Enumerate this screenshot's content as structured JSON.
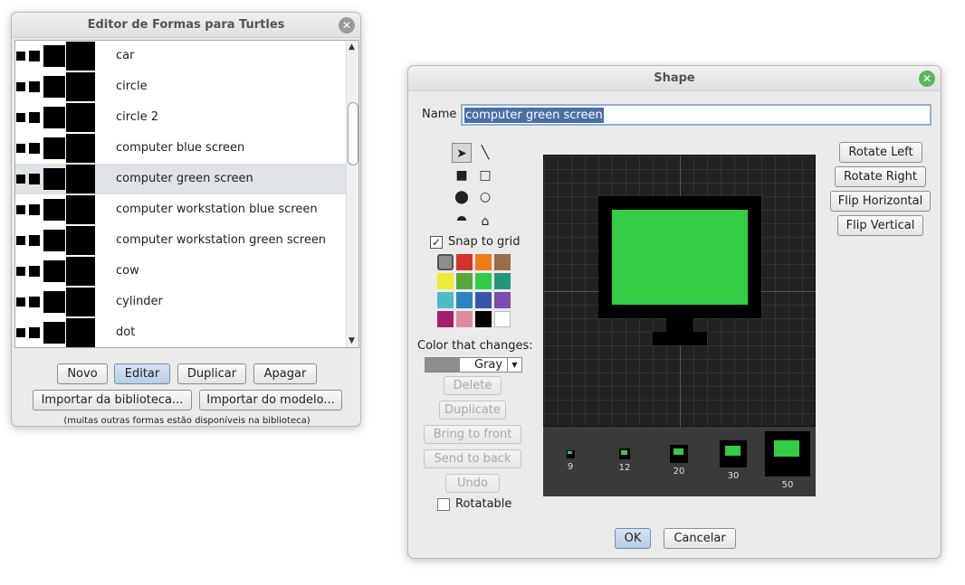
{
  "editor": {
    "title": "Editor de Formas para Turtles",
    "shapes": [
      {
        "label": "car",
        "icon": "car-icon"
      },
      {
        "label": "circle",
        "icon": "circle-icon"
      },
      {
        "label": "circle 2",
        "icon": "circle-2-icon"
      },
      {
        "label": "computer blue screen",
        "icon": "computer-blue-screen-icon"
      },
      {
        "label": "computer green screen",
        "icon": "computer-green-screen-icon"
      },
      {
        "label": "computer workstation blue screen",
        "icon": "computer-workstation-blue-screen-icon"
      },
      {
        "label": "computer workstation green screen",
        "icon": "computer-workstation-green-screen-icon"
      },
      {
        "label": "cow",
        "icon": "cow-icon"
      },
      {
        "label": "cylinder",
        "icon": "cylinder-icon"
      },
      {
        "label": "dot",
        "icon": "dot-icon"
      }
    ],
    "selected_index": 4,
    "buttons": {
      "new": "Novo",
      "edit": "Editar",
      "duplicate": "Duplicar",
      "delete": "Apagar",
      "import_library": "Importar da biblioteca...",
      "import_model": "Importar do modelo..."
    },
    "footnote": "(muitas outras formas estão disponíveis na biblioteca)"
  },
  "shape": {
    "title": "Shape",
    "name_label": "Name",
    "name_value": "computer green screen",
    "snap_label": "Snap to grid",
    "snap_checked": true,
    "color_changes_label": "Color that changes:",
    "color_changes_value": "Gray",
    "buttons": {
      "delete": "Delete",
      "duplicate": "Duplicate",
      "bring_front": "Bring to front",
      "send_back": "Send to back",
      "undo": "Undo",
      "rotate_left": "Rotate Left",
      "rotate_right": "Rotate Right",
      "flip_h": "Flip Horizontal",
      "flip_v": "Flip Vertical",
      "ok": "OK",
      "cancel": "Cancelar"
    },
    "rotatable_label": "Rotatable",
    "rotatable_checked": false,
    "sizes": [
      "9",
      "12",
      "20",
      "30",
      "50"
    ],
    "palette": [
      "#8d8d8d",
      "#d7302a",
      "#f07a16",
      "#9c6b47",
      "#eceb35",
      "#58a73c",
      "#33c94a",
      "#22987a",
      "#4bbdc6",
      "#2c84c4",
      "#3656a8",
      "#7f4db0",
      "#a61d6b",
      "#e08a9e",
      "#000000",
      "#ffffff"
    ],
    "colors": {
      "screen": "#33cc44",
      "bezel": "#000000",
      "canvas": "#222222",
      "preview_bg": "#3a3a3a"
    }
  }
}
